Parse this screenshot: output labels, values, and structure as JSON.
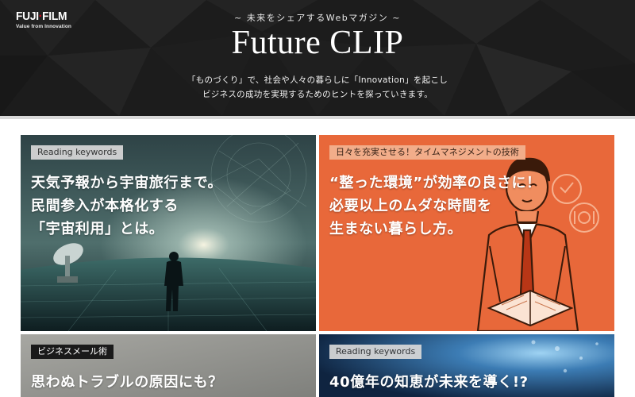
{
  "header": {
    "logo": {
      "word_left": "FUJI",
      "word_dot": "·",
      "word_right": "FILM",
      "tagline": "Value from Innovation",
      "accent_color": "#e60012"
    },
    "tagline": "~ 未来をシェアするWebマガジン ~",
    "title": "Future CLIP",
    "intro_lines": [
      "「ものづくり」で、社会や人々の暮らしに「Innovation」を起こし",
      "ビジネスの成功を実現するためのヒントを探っていきます。"
    ]
  },
  "cards": [
    {
      "badge": "Reading keywords",
      "headline": [
        "天気予報から宇宙旅行まで。",
        "民間参入が本格化する",
        "「宇宙利用」とは。"
      ],
      "image": "night-sky-satellite-person",
      "accent": "#1f4a52"
    },
    {
      "badge": "日々を充実させる！タイムマネジメントの技術",
      "headline": [
        "“整った環境”が効率の良さに！",
        "必要以上のムダな時間を",
        "生まない暮らし方。"
      ],
      "image": "businessman-illustration",
      "accent": "#e8683a"
    },
    {
      "badge": "ビジネスメール術",
      "headline": [
        "思わぬトラブルの原因にも？"
      ],
      "image": "grey-photo",
      "accent": "#9a9a96"
    },
    {
      "badge": "Reading keywords",
      "headline": [
        "40億年の知恵が未来を導く!?"
      ],
      "image": "blue-water-globe",
      "accent": "#1b3c63"
    }
  ]
}
